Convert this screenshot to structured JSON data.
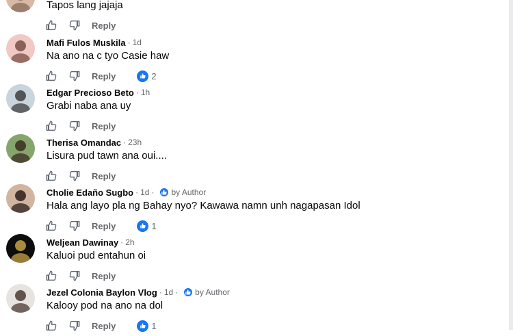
{
  "comments": [
    {
      "name": "",
      "time": "",
      "text": "Tapos lang jajaja",
      "reply_label": "Reply",
      "reaction_count": "",
      "author": "",
      "avatar_colors": [
        "#d8b9a6",
        "#8a6a58"
      ]
    },
    {
      "name": "Mafi Fulos Muskila",
      "time": "1d",
      "text": "Na ano na c tyo Casie haw",
      "reply_label": "Reply",
      "reaction_count": "2",
      "author": "",
      "avatar_colors": [
        "#f0c9c4",
        "#7a4e47"
      ]
    },
    {
      "name": "Edgar Precioso Beto",
      "time": "1h",
      "text": "Grabi naba ana uy",
      "reply_label": "Reply",
      "reaction_count": "",
      "author": "",
      "avatar_colors": [
        "#c9d4dd",
        "#3d3d3d"
      ]
    },
    {
      "name": "Therisa Omandac",
      "time": "23h",
      "text": "Lisura pud tawn ana oui....",
      "reply_label": "Reply",
      "reaction_count": "",
      "author": "",
      "avatar_colors": [
        "#86a56c",
        "#3b2b22"
      ]
    },
    {
      "name": "Cholie Edaño Sugbo",
      "time": "1d",
      "text": "Hala ang layo pla ng Bahay nyo? Kawawa namn unh nagapasan Idol",
      "reply_label": "Reply",
      "reaction_count": "1",
      "author": "by Author",
      "avatar_colors": [
        "#d2b59f",
        "#2a1f1a"
      ]
    },
    {
      "name": "Weljean Dawinay",
      "time": "2h",
      "text": "Kaluoi pud entahun oi",
      "reply_label": "Reply",
      "reaction_count": "",
      "author": "",
      "avatar_colors": [
        "#0d0d0d",
        "#c7a347"
      ]
    },
    {
      "name": "Jezel Colonia Baylon Vlog",
      "time": "1d",
      "text": "Kalooy pod na ano na dol",
      "reply_label": "Reply",
      "reaction_count": "1",
      "author": "by Author",
      "avatar_colors": [
        "#e7e3e0",
        "#4b3a33"
      ]
    }
  ],
  "colors": {
    "accent": "#1877f2",
    "secondary_text": "#65676b",
    "primary_text": "#050505"
  },
  "icons": {
    "like": "thumbs-up-icon",
    "dislike": "thumbs-down-icon",
    "reaction": "like-reaction-icon",
    "author": "author-badge-icon"
  }
}
